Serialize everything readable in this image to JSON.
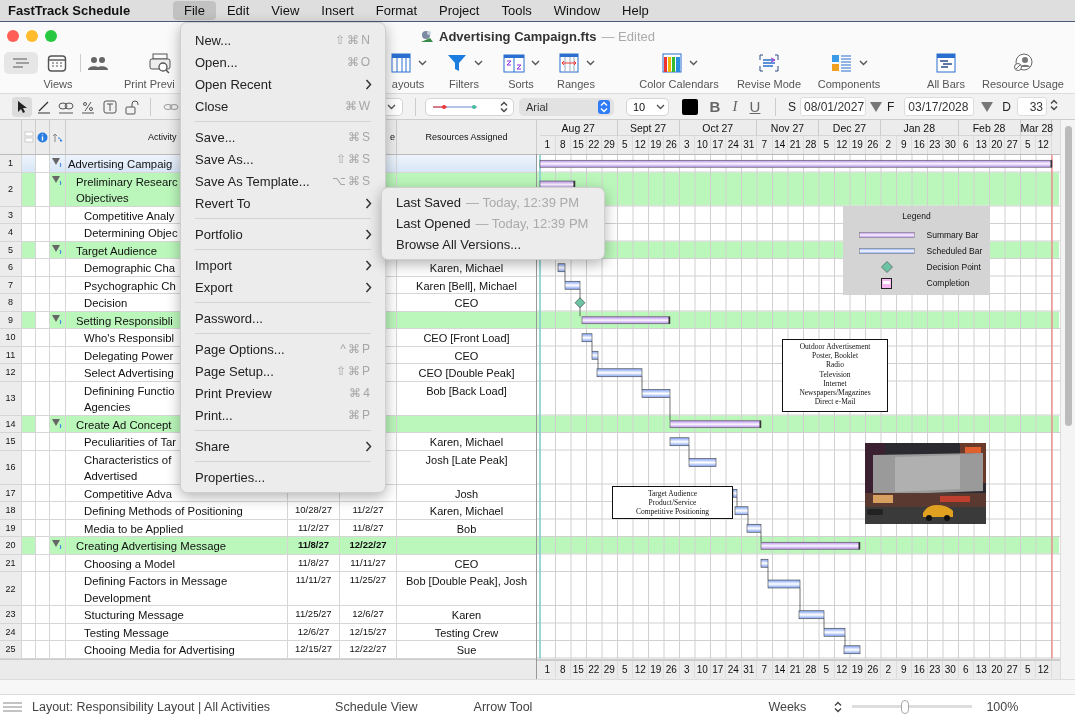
{
  "menu_bar": {
    "app_name": "FastTrack Schedule",
    "menus": [
      {
        "label": "File",
        "selected": true
      },
      {
        "label": "Edit",
        "selected": false
      },
      {
        "label": "View",
        "selected": false
      },
      {
        "label": "Insert",
        "selected": false
      },
      {
        "label": "Format",
        "selected": false
      },
      {
        "label": "Project",
        "selected": false
      },
      {
        "label": "Tools",
        "selected": false
      },
      {
        "label": "Window",
        "selected": false
      },
      {
        "label": "Help",
        "selected": false
      }
    ]
  },
  "window": {
    "title": "Advertising Campaign.fts",
    "status": "— Edited"
  },
  "toolbar": [
    {
      "kind": "views",
      "label": "Views",
      "segments": [
        {
          "selected": true
        },
        {
          "selected": false
        }
      ]
    },
    {
      "kind": "button",
      "label": "Print Previ"
    },
    {
      "kind": "menu",
      "label": "ayouts"
    },
    {
      "kind": "menu",
      "label": "Filters"
    },
    {
      "kind": "menu",
      "label": "Sorts"
    },
    {
      "kind": "menu",
      "label": "Ranges"
    },
    {
      "kind": "menu",
      "label": "Color Calendars"
    },
    {
      "kind": "button",
      "label": "Revise Mode"
    },
    {
      "kind": "menu",
      "label": "Components"
    },
    {
      "kind": "button",
      "label": "All Bars"
    },
    {
      "kind": "button",
      "label": "Resource Usage"
    }
  ],
  "format_bar": {
    "tools": [
      {
        "kind": "arrow",
        "selected": true
      },
      {
        "kind": "pencil",
        "selected": false
      },
      {
        "kind": "link",
        "selected": false
      },
      {
        "kind": "percent",
        "selected": false
      },
      {
        "kind": "text",
        "selected": false
      },
      {
        "kind": "lock",
        "selected": false
      },
      {
        "kind": "chain",
        "selected": false
      }
    ],
    "font": "Arial",
    "font_size": "10",
    "style_buttons": [
      "B",
      "I",
      "U"
    ],
    "start_label": "S",
    "start_date": "08/01/2027",
    "finish_label": "F",
    "finish_date": "03/17/2028",
    "duration_label": "D",
    "duration": "33"
  },
  "table": {
    "headers": {
      "activity": "Activity",
      "column_3": "e",
      "resources": "Resources Assigned"
    },
    "rows": [
      {
        "number": "1",
        "kind": "project",
        "activity": [
          "Advertising Campaig"
        ],
        "selected": true,
        "bar": {
          "kind": "summary"
        },
        "children": [
          {
            "number": "2",
            "kind": "group",
            "activity": [
              "Preliminary Researc",
              "Objectives"
            ],
            "selected": false,
            "bar": {
              "kind": "summary"
            },
            "children": [
              {
                "number": "3",
                "kind": "task",
                "activity": [
                  "Competitive Analy"
                ],
                "selected": false
              },
              {
                "number": "4",
                "kind": "task",
                "activity": [
                  "Determining Objec"
                ],
                "selected": false
              }
            ]
          },
          {
            "number": "5",
            "kind": "group",
            "activity": [
              "Target Audience"
            ],
            "selected": false,
            "children": [
              {
                "number": "6",
                "kind": "task",
                "activity": [
                  "Demographic Cha"
                ],
                "resources": "Karen, Michael",
                "selected": false,
                "bar": {
                  "kind": "scheduled"
                }
              },
              {
                "number": "7",
                "kind": "task",
                "activity": [
                  "Psychographic Ch"
                ],
                "resources": "Karen [Bell], Michael",
                "selected": false,
                "bar": {
                  "kind": "scheduled"
                }
              },
              {
                "number": "8",
                "kind": "task",
                "activity": [
                  "Decision"
                ],
                "resources": "CEO",
                "selected": false,
                "bar": {
                  "kind": "decision"
                }
              }
            ]
          },
          {
            "number": "9",
            "kind": "group",
            "activity": [
              "Setting Responsibli"
            ],
            "selected": false,
            "bar": {
              "kind": "summary"
            },
            "children": [
              {
                "number": "10",
                "kind": "task",
                "activity": [
                  "Who's Responsibl"
                ],
                "resources": "CEO [Front Load]",
                "selected": false,
                "bar": {
                  "kind": "scheduled"
                }
              },
              {
                "number": "11",
                "kind": "task",
                "activity": [
                  "Delegating Power"
                ],
                "resources": "CEO",
                "selected": false,
                "bar": {
                  "kind": "scheduled"
                }
              },
              {
                "number": "12",
                "kind": "task",
                "activity": [
                  "Select Advertising"
                ],
                "resources": "CEO [Double Peak]",
                "selected": false,
                "bar": {
                  "kind": "scheduled"
                }
              },
              {
                "number": "13",
                "kind": "task",
                "activity": [
                  "Definining Functio",
                  "Agencies"
                ],
                "resources": "Bob [Back Load]",
                "selected": false,
                "bar": {
                  "kind": "scheduled"
                }
              }
            ]
          },
          {
            "number": "14",
            "kind": "group",
            "activity": [
              "Create Ad Concept"
            ],
            "selected": false,
            "bar": {
              "kind": "summary"
            },
            "children": [
              {
                "number": "15",
                "kind": "task",
                "activity": [
                  "Peculiarities of Tar"
                ],
                "resources": "Karen, Michael",
                "selected": false,
                "bar": {
                  "kind": "scheduled"
                }
              },
              {
                "number": "16",
                "kind": "task",
                "activity": [
                  "Characteristics of",
                  "Advertised"
                ],
                "resources": "Josh [Late Peak]",
                "selected": false,
                "bar": {
                  "kind": "scheduled"
                }
              },
              {
                "number": "17",
                "kind": "task",
                "activity": [
                  "Competitive Adva"
                ],
                "resources": "Josh",
                "selected": false,
                "bar": {
                  "kind": "scheduled"
                }
              },
              {
                "number": "18",
                "kind": "task",
                "activity": [
                  "Defining Methods of Positioning"
                ],
                "start": "10/28/27",
                "finish": "11/2/27",
                "resources": "Karen, Michael",
                "selected": false,
                "bar": {
                  "kind": "scheduled"
                }
              },
              {
                "number": "19",
                "kind": "task",
                "activity": [
                  "Media to be Applied"
                ],
                "start": "11/2/27",
                "finish": "11/8/27",
                "resources": "Bob",
                "selected": false,
                "bar": {
                  "kind": "scheduled"
                }
              }
            ]
          },
          {
            "number": "20",
            "kind": "group",
            "activity": [
              "Creating Advertising Message"
            ],
            "start": "11/8/27",
            "finish": "12/22/27",
            "selected": false,
            "bar": {
              "kind": "summary"
            },
            "children": [
              {
                "number": "21",
                "kind": "task",
                "activity": [
                  "Choosing a Model"
                ],
                "start": "11/8/27",
                "finish": "11/11/27",
                "resources": "CEO",
                "selected": false,
                "bar": {
                  "kind": "scheduled"
                }
              },
              {
                "number": "22",
                "kind": "task",
                "activity": [
                  "Defining Factors in Message",
                  "Development"
                ],
                "start": "11/11/27",
                "finish": "11/25/27",
                "resources": "Bob [Double Peak], Josh",
                "selected": false,
                "bar": {
                  "kind": "scheduled"
                }
              },
              {
                "number": "23",
                "kind": "task",
                "activity": [
                  "Stucturing Message"
                ],
                "start": "11/25/27",
                "finish": "12/6/27",
                "resources": "Karen",
                "selected": false,
                "bar": {
                  "kind": "scheduled"
                }
              },
              {
                "number": "24",
                "kind": "task",
                "activity": [
                  "Testing Message"
                ],
                "start": "12/6/27",
                "finish": "12/15/27",
                "resources": "Testing Crew",
                "selected": false,
                "bar": {
                  "kind": "scheduled"
                }
              },
              {
                "number": "25",
                "kind": "task",
                "activity": [
                  "Chooing Media for Advertising"
                ],
                "start": "12/15/27",
                "finish": "12/22/27",
                "resources": "Sue",
                "selected": false,
                "bar": {
                  "kind": "scheduled"
                }
              }
            ]
          }
        ]
      }
    ]
  },
  "timescale": {
    "months": [
      {
        "label": "Aug 27",
        "weeks": [
          "1",
          "8",
          "15",
          "22",
          "29"
        ]
      },
      {
        "label": "Sept 27",
        "weeks": [
          "5",
          "12",
          "19",
          "26"
        ]
      },
      {
        "label": "Oct 27",
        "weeks": [
          "3",
          "10",
          "17",
          "24",
          "31"
        ]
      },
      {
        "label": "Nov 27",
        "weeks": [
          "7",
          "14",
          "21",
          "28"
        ]
      },
      {
        "label": "Dec 27",
        "weeks": [
          "5",
          "12",
          "19",
          "26"
        ]
      },
      {
        "label": "Jan 28",
        "weeks": [
          "2",
          "9",
          "16",
          "23",
          "30"
        ]
      },
      {
        "label": "Feb 28",
        "weeks": [
          "6",
          "13",
          "20",
          "27"
        ]
      },
      {
        "label": "Mar 28",
        "weeks": [
          "5",
          "12"
        ]
      }
    ],
    "bottom_weeks": [
      "1",
      "8",
      "15",
      "22",
      "29",
      "5",
      "12",
      "19",
      "26",
      "3",
      "10",
      "17",
      "24",
      "31",
      "7",
      "14",
      "21",
      "28",
      "5",
      "12",
      "19",
      "26",
      "2",
      "9",
      "16",
      "23",
      "30",
      "6",
      "13",
      "20",
      "27",
      "5",
      "12"
    ]
  },
  "legend": {
    "title": "Legend",
    "items": [
      {
        "kind": "summary",
        "label": "Summary Bar"
      },
      {
        "kind": "scheduled",
        "label": "Scheduled Bar"
      },
      {
        "kind": "decision",
        "label": "Decision Point"
      },
      {
        "kind": "completion",
        "label": "Completion"
      }
    ]
  },
  "notes": [
    {
      "lines": [
        "Outdoor Advertisement",
        "Poster, Booklet",
        "Radio",
        "Television",
        "Internet",
        "Newspapers/Magazines",
        "Direct e-Mail"
      ]
    },
    {
      "lines": [
        "Target Audience",
        "Product/Service",
        "Competitive Positioning"
      ]
    }
  ],
  "file_menu": {
    "items": [
      {
        "kind": "item",
        "label": "New...",
        "shortcut": "⇧⌘N"
      },
      {
        "kind": "item",
        "label": "Open...",
        "shortcut": "⌘O"
      },
      {
        "kind": "submenu",
        "label": "Open Recent"
      },
      {
        "kind": "item",
        "label": "Close",
        "shortcut": "⌘W"
      },
      {
        "kind": "separator"
      },
      {
        "kind": "item",
        "label": "Save...",
        "shortcut": "⌘S"
      },
      {
        "kind": "item",
        "label": "Save As...",
        "shortcut": "⇧⌘S"
      },
      {
        "kind": "item",
        "label": "Save As Template...",
        "shortcut": "⌥⌘S"
      },
      {
        "kind": "submenu",
        "label": "Revert To"
      },
      {
        "kind": "separator"
      },
      {
        "kind": "submenu",
        "label": "Portfolio"
      },
      {
        "kind": "separator"
      },
      {
        "kind": "submenu",
        "label": "Import"
      },
      {
        "kind": "submenu",
        "label": "Export"
      },
      {
        "kind": "separator"
      },
      {
        "kind": "item",
        "label": "Password..."
      },
      {
        "kind": "separator"
      },
      {
        "kind": "item",
        "label": "Page Options...",
        "shortcut": "^⌘P"
      },
      {
        "kind": "item",
        "label": "Page Setup...",
        "shortcut": "⇧⌘P"
      },
      {
        "kind": "item",
        "label": "Print Preview",
        "shortcut": "⌘4"
      },
      {
        "kind": "item",
        "label": "Print...",
        "shortcut": "⌘P"
      },
      {
        "kind": "separator"
      },
      {
        "kind": "submenu",
        "label": "Share"
      },
      {
        "kind": "separator"
      },
      {
        "kind": "item",
        "label": "Properties..."
      }
    ]
  },
  "revert_submenu": {
    "items": [
      {
        "label": "Last Saved",
        "detail": "— Today, 12:39 PM"
      },
      {
        "label": "Last Opened",
        "detail": "— Today, 12:39 PM"
      },
      {
        "label": "Browse All Versions..."
      }
    ]
  },
  "status_bar": {
    "layout": "Layout: Responsibility Layout | All Activities",
    "view": "Schedule View",
    "tool": "Arrow Tool",
    "scale": "Weeks",
    "zoom": {
      "level": 0.43
    },
    "zoom_label": "100%"
  }
}
